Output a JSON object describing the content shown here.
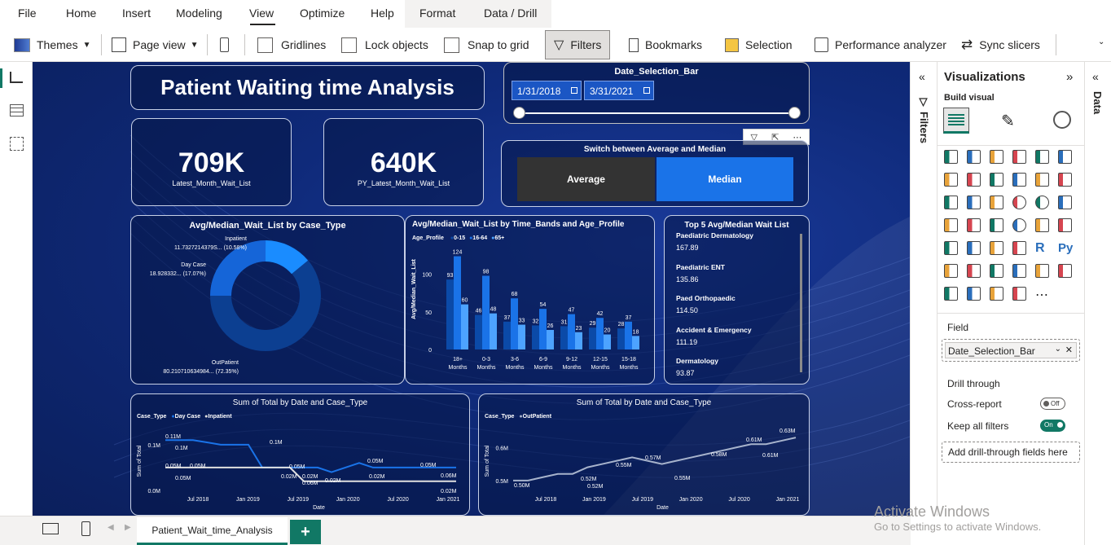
{
  "menu": {
    "items": [
      "File",
      "Home",
      "Insert",
      "Modeling",
      "View",
      "Optimize",
      "Help",
      "Format",
      "Data / Drill"
    ],
    "active": "View"
  },
  "toolbar": {
    "themes": "Themes",
    "page_view": "Page view",
    "gridlines": "Gridlines",
    "lock_objects": "Lock objects",
    "snap_to_grid": "Snap to grid",
    "filters": "Filters",
    "bookmarks": "Bookmarks",
    "selection": "Selection",
    "performance_analyzer": "Performance analyzer",
    "sync_slicers": "Sync slicers"
  },
  "report": {
    "title": "Patient Waiting time Analysis",
    "date_slicer": {
      "title": "Date_Selection_Bar",
      "start": "1/31/2018",
      "end": "3/31/2021"
    },
    "kpi1": {
      "value": "709K",
      "label": "Latest_Month_Wait_List"
    },
    "kpi2": {
      "value": "640K",
      "label": "PY_Latest_Month_Wait_List"
    },
    "switch": {
      "title": "Switch between Average and Median",
      "average": "Average",
      "median": "Median"
    },
    "donut": {
      "title": "Avg/Median_Wait_List by Case_Type",
      "inpatient_label": "Inpatient",
      "inpatient_value": "11.7327214379S... (10.58%)",
      "daycase_label": "Day Case",
      "daycase_value": "18.928332... (17.07%)",
      "outpatient_label": "OutPatient",
      "outpatient_value": "80.210710634984... (72.35%)"
    },
    "top5": {
      "title": "Top 5 Avg/Median Wait List",
      "items": [
        {
          "name": "Paediatric Dermatology",
          "value": "167.89"
        },
        {
          "name": "Paediatric ENT",
          "value": "135.86"
        },
        {
          "name": "Paed Orthopaedic",
          "value": "114.50"
        },
        {
          "name": "Accident & Emergency",
          "value": "111.19"
        },
        {
          "name": "Dermatology",
          "value": "93.87"
        }
      ]
    },
    "line1_title": "Sum of Total by Date and Case_Type",
    "line2_title": "Sum of Total by Date and Case_Type"
  },
  "chart_data": [
    {
      "type": "bar",
      "title": "Avg/Median_Wait_List by Time_Bands and Age_Profile",
      "ylabel": "Avg/Median_Wait_List",
      "legend_title": "Age_Profile",
      "categories": [
        "18+ Months",
        "0-3 Months",
        "3-6 Months",
        "6-9 Months",
        "9-12 Months",
        "12-15 Months",
        "15-18 Months"
      ],
      "yticks": [
        "0",
        "50",
        "100"
      ],
      "ylim": [
        0,
        130
      ],
      "series": [
        {
          "name": "0-15",
          "values": [
            93,
            46,
            37,
            32,
            31,
            29,
            28
          ],
          "color": "#0b4aa8"
        },
        {
          "name": "16-64",
          "values": [
            124,
            98,
            68,
            54,
            47,
            42,
            37
          ],
          "color": "#1a73e8"
        },
        {
          "name": "65+",
          "values": [
            60,
            48,
            33,
            26,
            23,
            20,
            18
          ],
          "color": "#4da3ff"
        }
      ]
    },
    {
      "type": "line",
      "title": "Sum of Total by Date and Case_Type",
      "legend_title": "Case_Type",
      "xlabel": "Date",
      "ylabel": "Sum of Total",
      "xticks": [
        "Jul 2018",
        "Jan 2019",
        "Jul 2019",
        "Jan 2020",
        "Jul 2020",
        "Jan 2021"
      ],
      "yticks": [
        "0.0M",
        "0.1M"
      ],
      "ylim": [
        0,
        0.13
      ],
      "series": [
        {
          "name": "Day Case",
          "color": "#1a73e8",
          "values": [
            0.11,
            0.11,
            0.11,
            0.105,
            0.1,
            0.1,
            0.1,
            0.05,
            0.05,
            0.05,
            0.05,
            0.05,
            0.04,
            0.05,
            0.06,
            0.05,
            0.05,
            0.05,
            0.05,
            0.05,
            0.05,
            0.05
          ]
        },
        {
          "name": "Inpatient",
          "color": "#e0e0e0",
          "values": [
            0.05,
            0.05,
            0.05,
            0.05,
            0.05,
            0.05,
            0.05,
            0.05,
            0.05,
            0.05,
            0.02,
            0.02,
            0.02,
            0.02,
            0.02,
            0.02,
            0.02,
            0.02,
            0.02,
            0.02,
            0.02,
            0.02
          ]
        }
      ],
      "labels": [
        "0.11M",
        "0.1M",
        "0.1M",
        "0.05M",
        "0.05M",
        "0.05M",
        "0.05M",
        "0.02M",
        "0.02M",
        "0.05M",
        "0.06M",
        "0.02M",
        "0.02M",
        "0.05M",
        "0.06M",
        "0.02M"
      ]
    },
    {
      "type": "line",
      "title": "Sum of Total by Date and Case_Type",
      "legend_title": "Case_Type",
      "xlabel": "Date",
      "ylabel": "Sum of Total",
      "xticks": [
        "Jul 2018",
        "Jan 2019",
        "Jul 2019",
        "Jan 2020",
        "Jul 2020",
        "Jan 2021"
      ],
      "yticks": [
        "0.5M",
        "0.6M"
      ],
      "ylim": [
        0.47,
        0.65
      ],
      "series": [
        {
          "name": "OutPatient",
          "color": "#a7b3cc",
          "values": [
            0.5,
            0.5,
            0.51,
            0.52,
            0.52,
            0.54,
            0.55,
            0.56,
            0.57,
            0.56,
            0.55,
            0.56,
            0.57,
            0.58,
            0.59,
            0.6,
            0.61,
            0.61,
            0.62,
            0.63
          ]
        }
      ],
      "labels": [
        "0.50M",
        "0.52M",
        "0.52M",
        "0.55M",
        "0.57M",
        "0.55M",
        "0.58M",
        "0.61M",
        "0.61M",
        "0.63M"
      ]
    }
  ],
  "visualizations": {
    "title": "Visualizations",
    "build_visual": "Build visual",
    "field_label": "Field",
    "field_value": "Date_Selection_Bar",
    "drill_through": "Drill through",
    "cross_report": "Cross-report",
    "cross_report_state": "Off",
    "keep_all_filters": "Keep all filters",
    "keep_all_filters_state": "On",
    "add_drill": "Add drill-through fields here"
  },
  "panes": {
    "filters": "Filters",
    "data": "Data"
  },
  "page_tab": "Patient_Wait_time_Analysis",
  "watermark": {
    "line1": "Activate Windows",
    "line2": "Go to Settings to activate Windows."
  }
}
